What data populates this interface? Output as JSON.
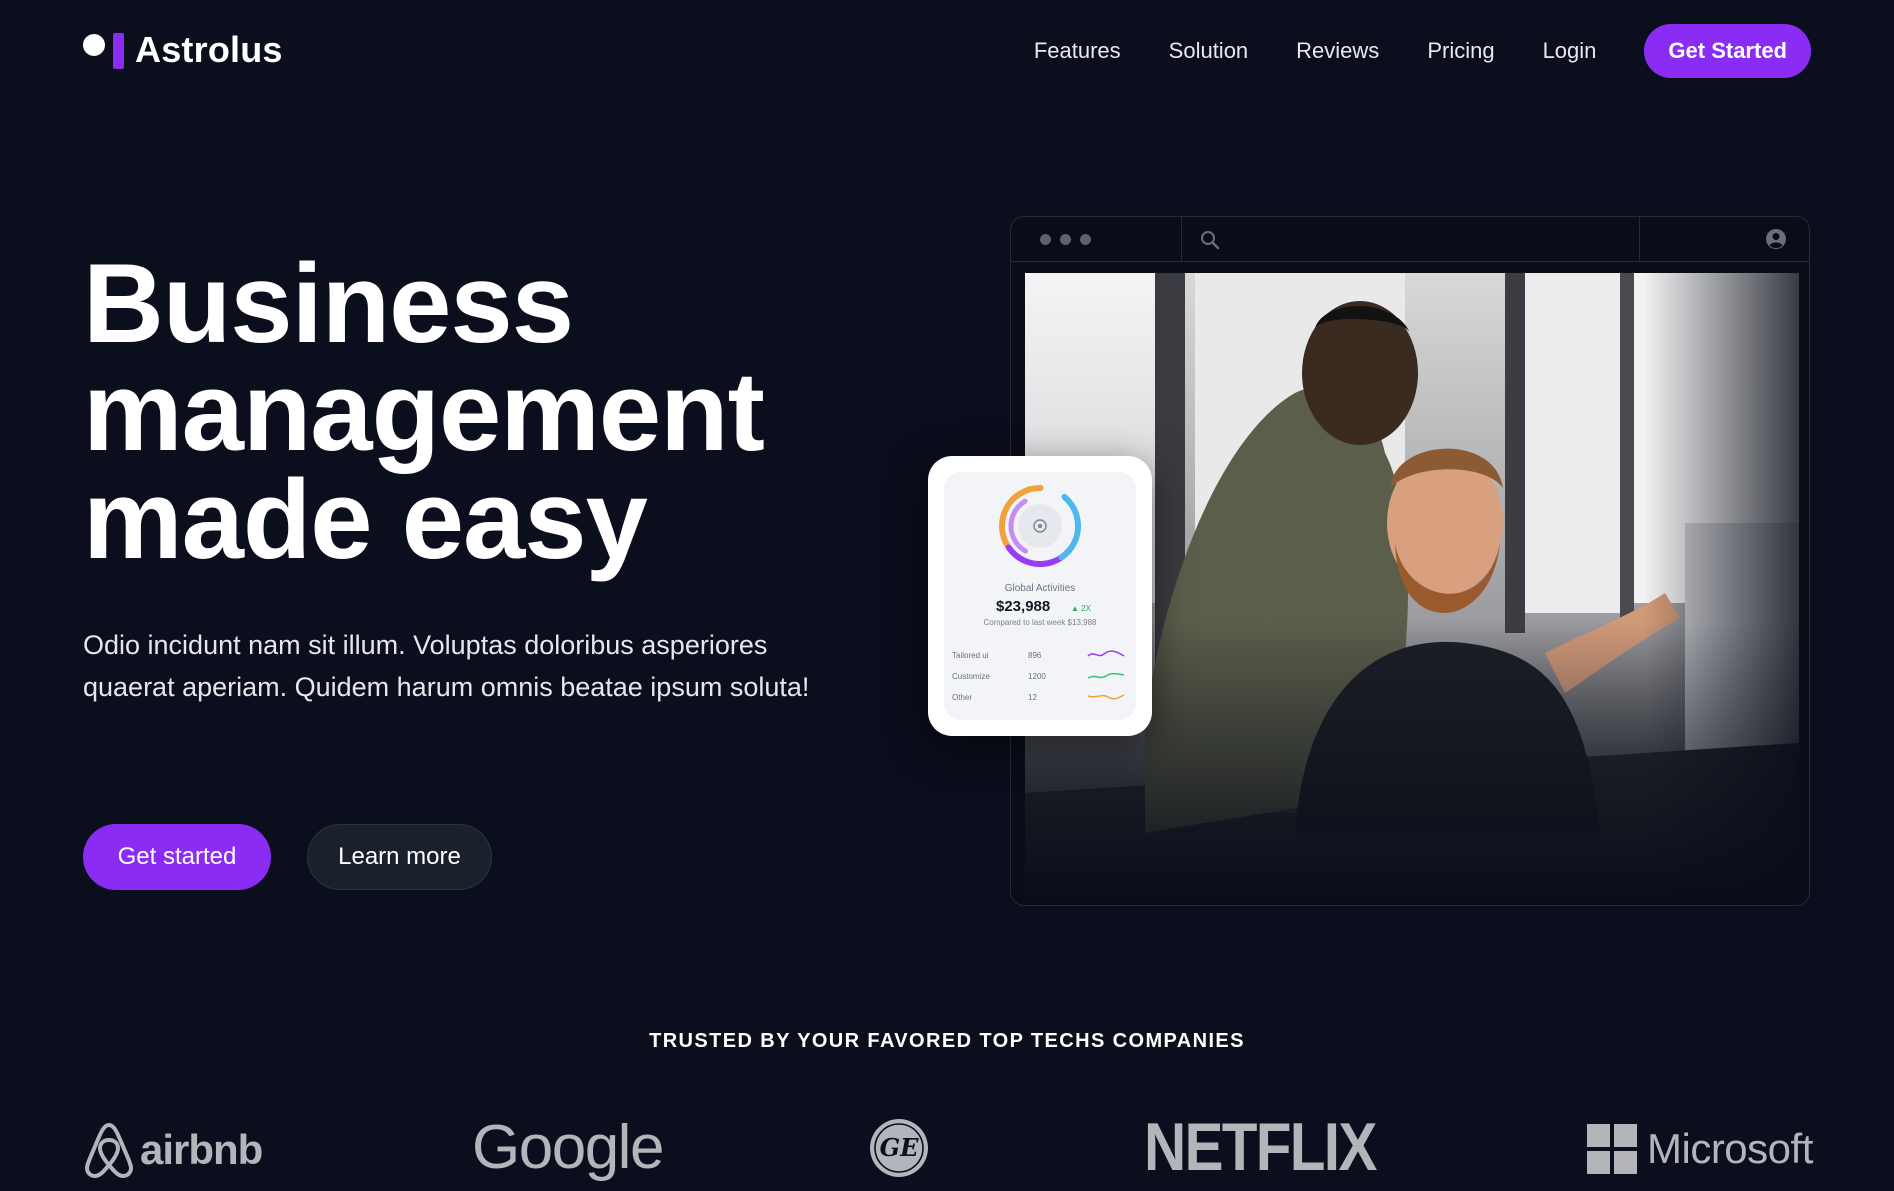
{
  "nav": {
    "brand": "Astrolus",
    "links": [
      "Features",
      "Solution",
      "Reviews",
      "Pricing",
      "Login"
    ],
    "cta": "Get Started"
  },
  "hero": {
    "title_lines": [
      "Business",
      "management",
      "made easy"
    ],
    "description": "Odio incidunt nam sit illum. Voluptas doloribus asperiores quaerat aperiam. Quidem harum omnis beatae ipsum soluta!",
    "primary_button": "Get started",
    "secondary_button": "Learn more"
  },
  "browser": {
    "window_dots": 3,
    "icons": [
      "search-icon",
      "user-circle-icon"
    ],
    "photo": "two men smiling at a desk by a window"
  },
  "stat_card": {
    "label": "Global Activities",
    "value": "$23,988",
    "change": "▲ 2X",
    "compare": "Compared to last week $13,988",
    "rows": [
      {
        "label": "Tailored ui",
        "value": "896",
        "color": "#9b3cf2"
      },
      {
        "label": "Customize",
        "value": "1200",
        "color": "#34c27a"
      },
      {
        "label": "Other",
        "value": "12",
        "color": "#f2a23c"
      }
    ]
  },
  "trusted": {
    "heading": "TRUSTED BY YOUR FAVORED TOP TECHS COMPANIES",
    "logos": [
      "airbnb",
      "Google",
      "GE",
      "NETFLIX",
      "Microsoft"
    ]
  },
  "colors": {
    "background": "#0b0e1c",
    "accent": "#8b2cf5",
    "logo_gray": "#b3b5bb"
  }
}
